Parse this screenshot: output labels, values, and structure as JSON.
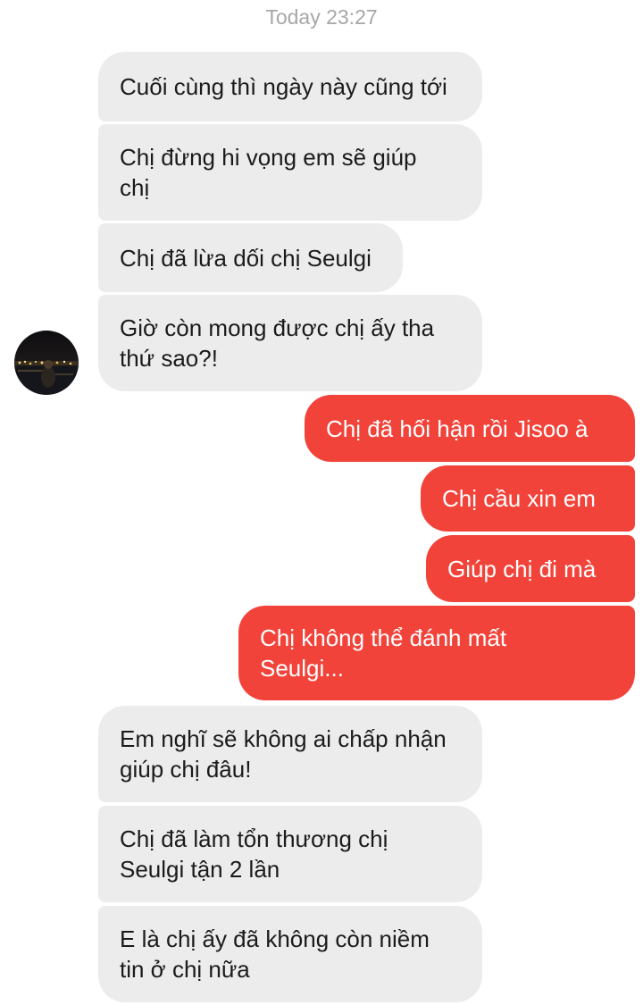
{
  "conversation": {
    "timestamp": "Today 23:27",
    "contact_avatar": "avatar-night-photo",
    "messages": [
      {
        "sender": "them",
        "text": "Cuối cùng thì ngày này cũng tới"
      },
      {
        "sender": "them",
        "text": "Chị đừng hi vọng em sẽ giúp chị"
      },
      {
        "sender": "them",
        "text": "Chị đã lừa dối chị Seulgi"
      },
      {
        "sender": "them",
        "text": "Giờ còn mong được chị ấy tha thứ sao?!"
      },
      {
        "sender": "me",
        "text": "Chị đã hối hận rồi Jisoo à"
      },
      {
        "sender": "me",
        "text": "Chị cầu xin em"
      },
      {
        "sender": "me",
        "text": "Giúp chị đi mà"
      },
      {
        "sender": "me",
        "text": "Chị không thể đánh mất Seulgi..."
      },
      {
        "sender": "them",
        "text": "Em nghĩ sẽ không ai chấp nhận giúp chị đâu!"
      },
      {
        "sender": "them",
        "text": "Chị đã làm tổn thương chị Seulgi tận 2 lần"
      },
      {
        "sender": "them",
        "text": "E là chị ấy đã không còn niềm tin ở chị nữa"
      }
    ]
  },
  "colors": {
    "incoming_bubble": "#ececec",
    "outgoing_bubble": "#f2433a",
    "timestamp_text": "#a7a7a7"
  }
}
